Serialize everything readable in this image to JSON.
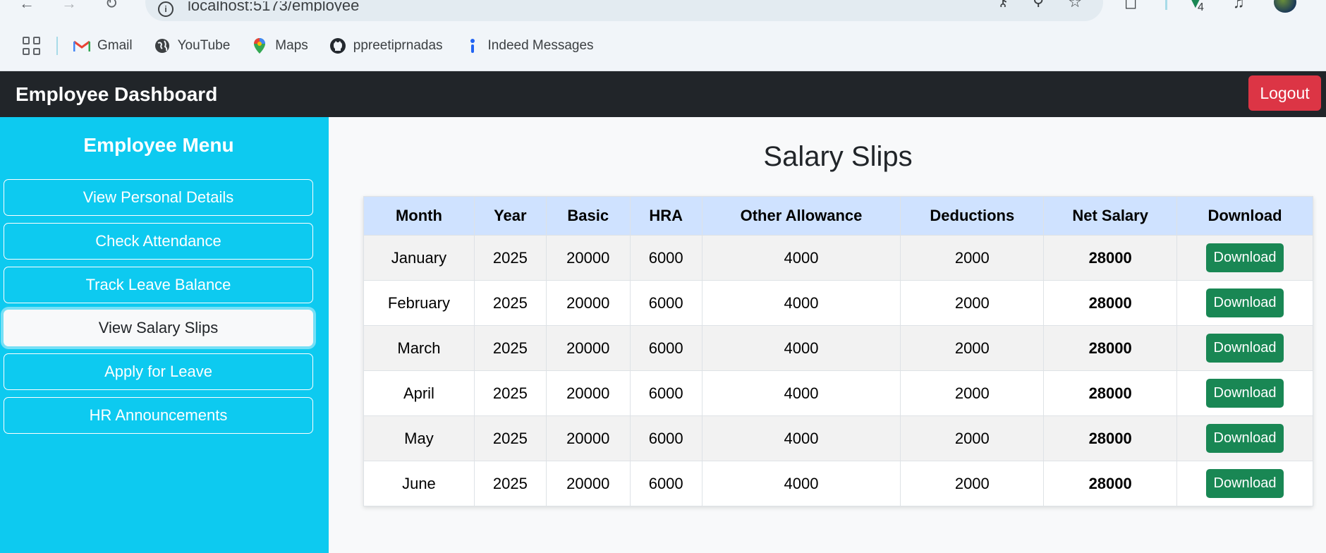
{
  "browser": {
    "url": "localhost:5173/employee",
    "download_count": "4",
    "bookmarks": [
      {
        "label": "Gmail",
        "icon": "gmail-icon"
      },
      {
        "label": "YouTube",
        "icon": "globe-icon"
      },
      {
        "label": "Maps",
        "icon": "maps-pin-icon"
      },
      {
        "label": "ppreetiprnadas",
        "icon": "github-icon"
      },
      {
        "label": "Indeed Messages",
        "icon": "indeed-icon"
      }
    ]
  },
  "navbar": {
    "title": "Employee Dashboard",
    "logout_label": "Logout"
  },
  "sidebar": {
    "title": "Employee Menu",
    "items": [
      {
        "label": "View Personal Details"
      },
      {
        "label": "Check Attendance"
      },
      {
        "label": "Track Leave Balance"
      },
      {
        "label": "View Salary Slips"
      },
      {
        "label": "Apply for Leave"
      },
      {
        "label": "HR Announcements"
      }
    ],
    "active_item": "View Salary Slips"
  },
  "main": {
    "title": "Salary Slips",
    "table": {
      "headers": [
        "Month",
        "Year",
        "Basic",
        "HRA",
        "Other Allowance",
        "Deductions",
        "Net Salary",
        "Download"
      ],
      "rows": [
        [
          "January",
          "2025",
          "20000",
          "6000",
          "4000",
          "2000",
          "28000",
          "Download"
        ],
        [
          "February",
          "2025",
          "20000",
          "6000",
          "4000",
          "2000",
          "28000",
          "Download"
        ],
        [
          "March",
          "2025",
          "20000",
          "6000",
          "4000",
          "2000",
          "28000",
          "Download"
        ],
        [
          "April",
          "2025",
          "20000",
          "6000",
          "4000",
          "2000",
          "28000",
          "Download"
        ],
        [
          "May",
          "2025",
          "20000",
          "6000",
          "4000",
          "2000",
          "28000",
          "Download"
        ],
        [
          "June",
          "2025",
          "20000",
          "6000",
          "4000",
          "2000",
          "28000",
          "Download"
        ]
      ]
    }
  },
  "colors": {
    "navbar_bg": "#212529",
    "sidebar_bg": "#0dcaf0",
    "logout_bg": "#dc3545",
    "download_bg": "#198754",
    "table_header_bg": "#cfe2ff"
  }
}
